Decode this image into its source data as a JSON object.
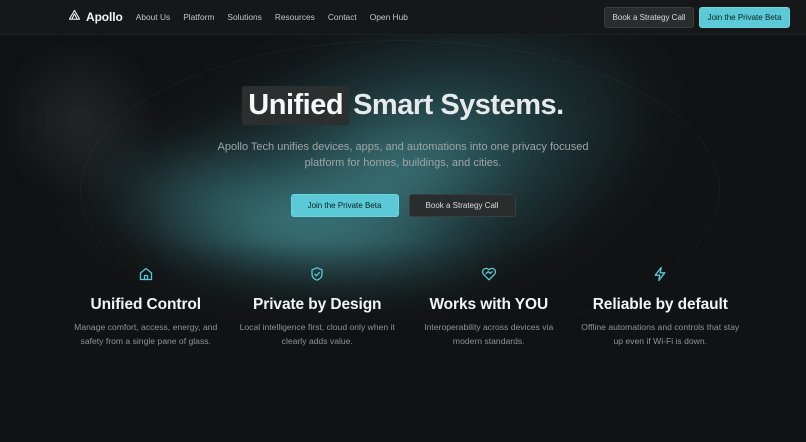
{
  "colors": {
    "accent": "#5ccad6",
    "background": "#111213",
    "dark_button": "#2a2d2e"
  },
  "header": {
    "brand": {
      "icon": "apollo-logo-icon",
      "name": "Apollo"
    },
    "nav": [
      "About Us",
      "Platform",
      "Solutions",
      "Resources",
      "Contact",
      "Open Hub"
    ],
    "actions": {
      "secondary_label": "Book a Strategy Call",
      "primary_label": "Join the Private Beta"
    }
  },
  "hero": {
    "title_highlight": "Unified",
    "title_rest": "Smart Systems.",
    "subtitle": "Apollo Tech unifies devices, apps, and automations into one privacy focused platform for homes, buildings, and cities.",
    "primary_label": "Join the Private Beta",
    "secondary_label": "Book a Strategy Call"
  },
  "features": [
    {
      "icon": "home-icon",
      "title": "Unified Control",
      "text": "Manage comfort, access, energy, and safety from a single pane of glass."
    },
    {
      "icon": "shield-check-icon",
      "title": "Private by Design",
      "text": "Local intelligence first, cloud only when it clearly adds value."
    },
    {
      "icon": "heart-handshake-icon",
      "title": "Works with YOU",
      "text": "Interoperability across devices via modern standards."
    },
    {
      "icon": "lightning-icon",
      "title": "Reliable by default",
      "text": "Offline automations and controls that stay up even if Wi-Fi is down."
    }
  ]
}
